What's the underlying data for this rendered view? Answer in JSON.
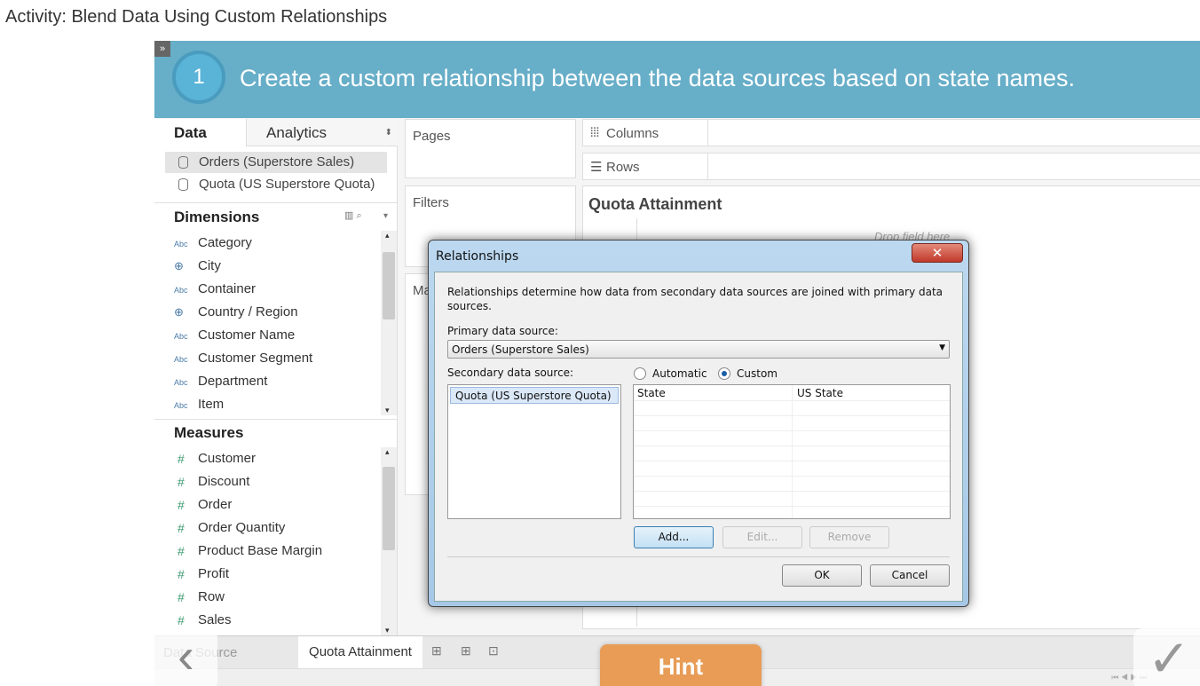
{
  "page_title": "Activity: Blend Data Using Custom Relationships",
  "step": {
    "number": "1",
    "instruction": "Create a custom relationship between the data sources based on state names."
  },
  "left_panel": {
    "tabs": [
      "Data",
      "Analytics"
    ],
    "data_sources": [
      "Orders (Superstore Sales)",
      "Quota (US Superstore Quota)"
    ],
    "dimensions_label": "Dimensions",
    "dimensions": [
      {
        "type": "Abc",
        "name": "Category"
      },
      {
        "type": "globe",
        "name": "City"
      },
      {
        "type": "Abc",
        "name": "Container"
      },
      {
        "type": "globe",
        "name": "Country / Region"
      },
      {
        "type": "Abc",
        "name": "Customer Name"
      },
      {
        "type": "Abc",
        "name": "Customer Segment"
      },
      {
        "type": "Abc",
        "name": "Department"
      },
      {
        "type": "Abc",
        "name": "Item"
      }
    ],
    "measures_label": "Measures",
    "measures": [
      "Customer",
      "Discount",
      "Order",
      "Order Quantity",
      "Product Base Margin",
      "Profit",
      "Row",
      "Sales"
    ]
  },
  "shelves": {
    "pages": "Pages",
    "filters": "Filters",
    "marks": "Ma",
    "columns": "Columns",
    "rows": "Rows"
  },
  "view": {
    "title": "Quota Attainment",
    "drop_hint": "Drop field here"
  },
  "dialog": {
    "title": "Relationships",
    "description": "Relationships determine how data from secondary data sources are joined with primary data sources.",
    "primary_label": "Primary data source:",
    "primary_value": "Orders (Superstore Sales)",
    "secondary_label": "Secondary data source:",
    "secondary_items": [
      "Quota (US Superstore Quota)"
    ],
    "mode_automatic": "Automatic",
    "mode_custom": "Custom",
    "selected_mode": "Custom",
    "table_headers": [
      "State",
      "US State"
    ],
    "add": "Add...",
    "edit": "Edit...",
    "remove": "Remove",
    "ok": "OK",
    "cancel": "Cancel"
  },
  "bottom": {
    "data_source_tab": "Data Source",
    "sheet_tab": "Quota Attainment",
    "hint": "Hint"
  },
  "colors": {
    "banner": "#67aec8",
    "hint": "#e89c56"
  }
}
